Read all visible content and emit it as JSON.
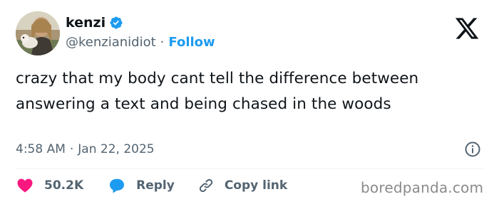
{
  "author": {
    "name": "kenzi",
    "handle": "@kenzianidiot",
    "separator": "·",
    "follow_label": "Follow",
    "avatar_icon": "profile-photo",
    "verified_icon": "verified-badge-icon"
  },
  "platform_icon": "x-logo-icon",
  "tweet": {
    "text": "crazy that my body cant tell the difference between answering a text and being chased in the woods",
    "time": "4:58 AM",
    "date_separator": "·",
    "date": "Jan 22, 2025",
    "info_icon": "info-icon"
  },
  "actions": {
    "likes": "50.2K",
    "reply_label": "Reply",
    "copy_label": "Copy link"
  },
  "watermark": "boredpanda.com",
  "colors": {
    "accent": "#1d9bf0",
    "like": "#f91880",
    "text": "#0f1419",
    "muted": "#536471"
  }
}
